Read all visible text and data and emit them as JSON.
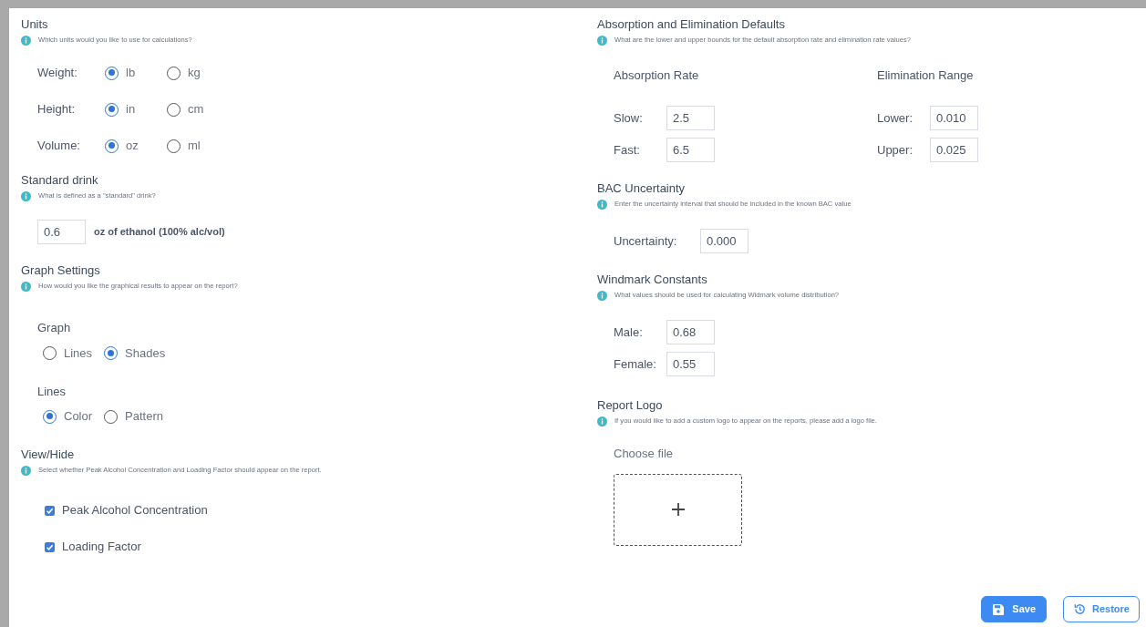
{
  "units": {
    "title": "Units",
    "hint": "Which units would you like to use for calculations?",
    "rows": [
      {
        "label": "Weight:",
        "options": [
          {
            "label": "lb",
            "selected": true
          },
          {
            "label": "kg",
            "selected": false
          }
        ]
      },
      {
        "label": "Height:",
        "options": [
          {
            "label": "in",
            "selected": true
          },
          {
            "label": "cm",
            "selected": false
          }
        ]
      },
      {
        "label": "Volume:",
        "options": [
          {
            "label": "oz",
            "selected": true
          },
          {
            "label": "ml",
            "selected": false
          }
        ]
      }
    ]
  },
  "standard_drink": {
    "title": "Standard drink",
    "hint": "What is defined as a \"standard\" drink?",
    "value": "0.6",
    "suffix": "oz of ethanol (100% alc/vol)"
  },
  "graph_settings": {
    "title": "Graph Settings",
    "hint": "How would you like the graphical results to appear on the report?",
    "groups": [
      {
        "label": "Graph",
        "options": [
          {
            "label": "Lines",
            "selected": false
          },
          {
            "label": "Shades",
            "selected": true
          }
        ]
      },
      {
        "label": "Lines",
        "options": [
          {
            "label": "Color",
            "selected": true
          },
          {
            "label": "Pattern",
            "selected": false
          }
        ]
      }
    ]
  },
  "view_hide": {
    "title": "View/Hide",
    "hint": "Select whether Peak Alcohol Concentration and Loading Factor should appear on the report.",
    "items": [
      {
        "label": "Peak Alcohol Concentration",
        "checked": true
      },
      {
        "label": "Loading Factor",
        "checked": true
      }
    ]
  },
  "absorption": {
    "title": "Absorption and Elimination Defaults",
    "hint": "What are the lower and upper bounds for the default absorption rate and elimination rate values?",
    "columns": [
      {
        "heading": "Absorption Rate",
        "fields": [
          {
            "label": "Slow:",
            "value": "2.5"
          },
          {
            "label": "Fast:",
            "value": "6.5"
          }
        ]
      },
      {
        "heading": "Elimination Range",
        "fields": [
          {
            "label": "Lower:",
            "value": "0.010"
          },
          {
            "label": "Upper:",
            "value": "0.025"
          }
        ]
      }
    ]
  },
  "bac_uncertainty": {
    "title": "BAC Uncertainty",
    "hint": "Enter the uncertainty interval that should be included in the known BAC value",
    "fields": [
      {
        "label": "Uncertainty:",
        "value": "0.000"
      }
    ]
  },
  "widmark": {
    "title": "Windmark Constants",
    "hint": "What values should be used for calculating Widmark volume distribution?",
    "fields": [
      {
        "label": "Male:",
        "value": "0.68"
      },
      {
        "label": "Female:",
        "value": "0.55"
      }
    ]
  },
  "report_logo": {
    "title": "Report Logo",
    "hint": "If you would like to add a custom logo to appear on the reports, please add a logo file.",
    "file_label": "Choose file"
  },
  "buttons": [
    {
      "label": "Save",
      "kind": "primary"
    },
    {
      "label": "Restore",
      "kind": "outline"
    }
  ]
}
